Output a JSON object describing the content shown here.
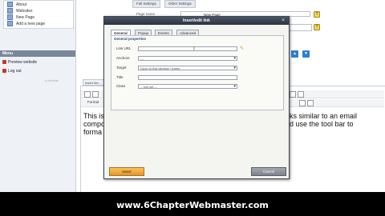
{
  "sidebar": {
    "pages": [
      "About",
      "Websites",
      "New Page",
      "Add a new page"
    ],
    "menu_title": "Menu",
    "menu_items": [
      {
        "label": "Preview website",
        "color": "#c0392b"
      },
      {
        "label": "Log out",
        "color": "#c0392b"
      }
    ],
    "note": "a website"
  },
  "background": {
    "tabs": [
      "Full Settings",
      "Other Settings"
    ],
    "page_name_label": "Page name",
    "page_name_value": "New Page"
  },
  "editor": {
    "tab": "Insert Me...",
    "format_label": "Format",
    "text_left": "This is … compo … forma",
    "text_right": "ks similar to an email\nd use the tool bar to"
  },
  "dialog": {
    "title": "Insert/edit link",
    "close": "×",
    "tabs": [
      "General",
      "Popup",
      "Events",
      "Advanced"
    ],
    "legend": "General properties",
    "fields": {
      "link_url": {
        "label": "Link URL",
        "value": ""
      },
      "anchors": {
        "label": "Anchors",
        "value": "---"
      },
      "target": {
        "label": "Target",
        "value": "Open in this window / frame"
      },
      "title": {
        "label": "Title",
        "value": ""
      },
      "class": {
        "label": "Class",
        "value": "-- Not set --"
      }
    },
    "insert_label": "Insert",
    "cancel_label": "Cancel"
  },
  "footer": {
    "text": "www.6ChapterWebmaster.com"
  },
  "colors": {
    "title_bar": "#2b3340",
    "insert_button": "#e8962a",
    "cancel_button": "#7d828c",
    "footer_bg": "#000000",
    "accent_blue": "#2d7fd0"
  }
}
